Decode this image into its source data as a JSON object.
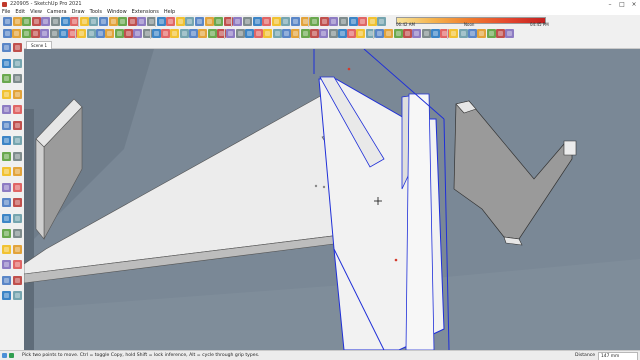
{
  "window": {
    "title": "220905 - SketchUp Pro 2021"
  },
  "menu": {
    "items": [
      "File",
      "Edit",
      "View",
      "Camera",
      "Draw",
      "Tools",
      "Window",
      "Extensions",
      "Help"
    ]
  },
  "shadow": {
    "times": [
      "06:42 AM",
      "Noon",
      "04:45 PM"
    ],
    "gradient_colors": [
      "#f7e39a",
      "#f5b24c",
      "#ef7a2d",
      "#e4472f",
      "#c2201f"
    ]
  },
  "scenes": {
    "tabs": [
      "Scene 1"
    ],
    "active": "Scene 1"
  },
  "status": {
    "text": "Pick two points to move.  Ctrl = toggle Copy, hold Shift = lock inference, Alt = cycle through grip types.",
    "measure_label": "Distance",
    "measure_value": "147 mm"
  },
  "colors": {
    "viewport_bg": "#7a8896",
    "selection": "#1f2fd8",
    "model_face": "#e8e8e8",
    "model_shade": "#8a8a8a",
    "accent_red": "#d33b2c"
  },
  "icons": {
    "toolbar": [
      "new-icon",
      "open-icon",
      "save-icon",
      "cut-icon",
      "copy-icon",
      "paste-icon",
      "erase-icon",
      "undo-icon",
      "redo-icon",
      "print-icon",
      "select-icon",
      "eraser-icon",
      "line-icon",
      "arc-icon",
      "shape-icon",
      "pushpull-icon",
      "move-icon",
      "rotate-icon",
      "scale-icon",
      "offset-icon",
      "tape-icon",
      "text-icon",
      "axes-icon",
      "paint-icon",
      "orbit-icon",
      "pan-icon",
      "zoom-icon",
      "zoom-extents-icon",
      "previous-icon",
      "next-icon",
      "component-icon",
      "warehouse-icon",
      "extension-icon",
      "shadow-icon",
      "style-icon"
    ],
    "left": [
      "select-icon",
      "component-icon",
      "eraser-icon",
      "paint-icon",
      "line-icon",
      "freehand-icon",
      "rectangle-icon",
      "rotated-rectangle-icon",
      "circle-icon",
      "polygon-icon",
      "arc-icon",
      "pie-icon",
      "move-icon",
      "pushpull-icon",
      "rotate-icon",
      "followme-icon",
      "scale-icon",
      "offset-icon",
      "tape-icon",
      "dimension-icon",
      "protractor-icon",
      "text-icon",
      "axes-icon",
      "3d-text-icon",
      "orbit-icon",
      "pan-icon",
      "zoom-icon",
      "zoom-window-icon",
      "zoom-extents-icon",
      "walk-icon",
      "position-camera-icon",
      "look-around-icon",
      "section-icon",
      "sandbox-icon"
    ]
  }
}
